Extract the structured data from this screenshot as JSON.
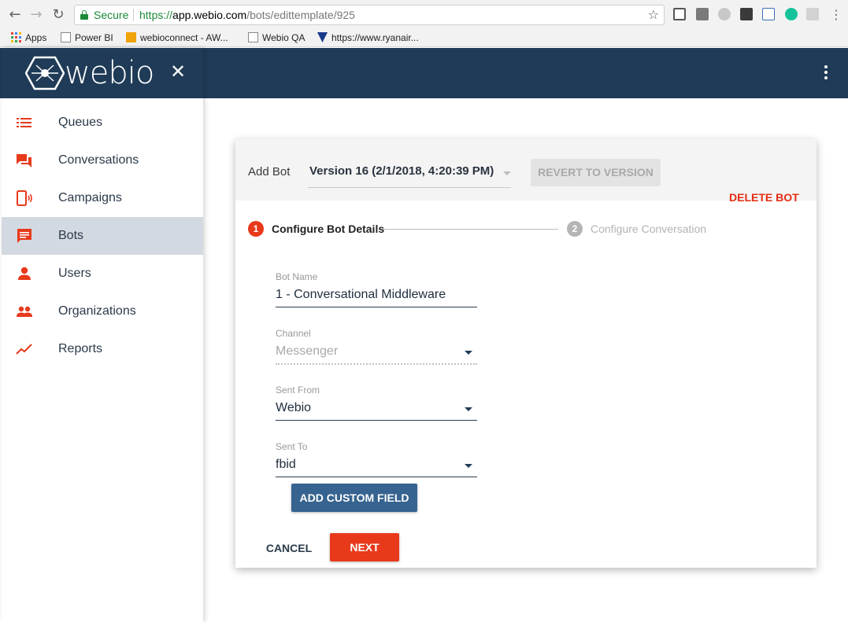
{
  "browser": {
    "secure_label": "Secure",
    "url_scheme": "https://",
    "url_host": "app.webio.com",
    "url_path": "/bots/edittemplate/925",
    "bookmarks": {
      "apps": "Apps",
      "powerbi": "Power BI",
      "webioconnect": "webioconnect - AW...",
      "webioqa": "Webio QA",
      "ryanair": "https://www.ryanair..."
    }
  },
  "sidebar": {
    "logo_text": "webio",
    "items": [
      {
        "label": "Queues",
        "icon": "list-icon"
      },
      {
        "label": "Conversations",
        "icon": "forum-icon"
      },
      {
        "label": "Campaigns",
        "icon": "phone-signal-icon"
      },
      {
        "label": "Bots",
        "icon": "chat-bubble-icon",
        "active": true
      },
      {
        "label": "Users",
        "icon": "person-icon"
      },
      {
        "label": "Organizations",
        "icon": "people-icon"
      },
      {
        "label": "Reports",
        "icon": "trending-up-icon"
      }
    ]
  },
  "colors": {
    "appbar": "#1f3b57",
    "accent": "#e8391b",
    "primary_button": "#36638f"
  },
  "card": {
    "add_bot": "Add Bot",
    "version": "Version 16 (2/1/2018, 4:20:39 PM)",
    "revert_label": "REVERT TO VERSION",
    "delete_label": "DELETE BOT",
    "steps": [
      {
        "number": "1",
        "label": "Configure Bot Details"
      },
      {
        "number": "2",
        "label": "Configure Conversation"
      }
    ],
    "fields": {
      "bot_name": {
        "label": "Bot Name",
        "value": "1 - Conversational Middleware"
      },
      "channel": {
        "label": "Channel",
        "value": "Messenger"
      },
      "sent_from": {
        "label": "Sent From",
        "value": "Webio"
      },
      "sent_to": {
        "label": "Sent To",
        "value": "fbid"
      }
    },
    "add_custom_field": "ADD CUSTOM FIELD",
    "cancel": "CANCEL",
    "next": "NEXT"
  }
}
